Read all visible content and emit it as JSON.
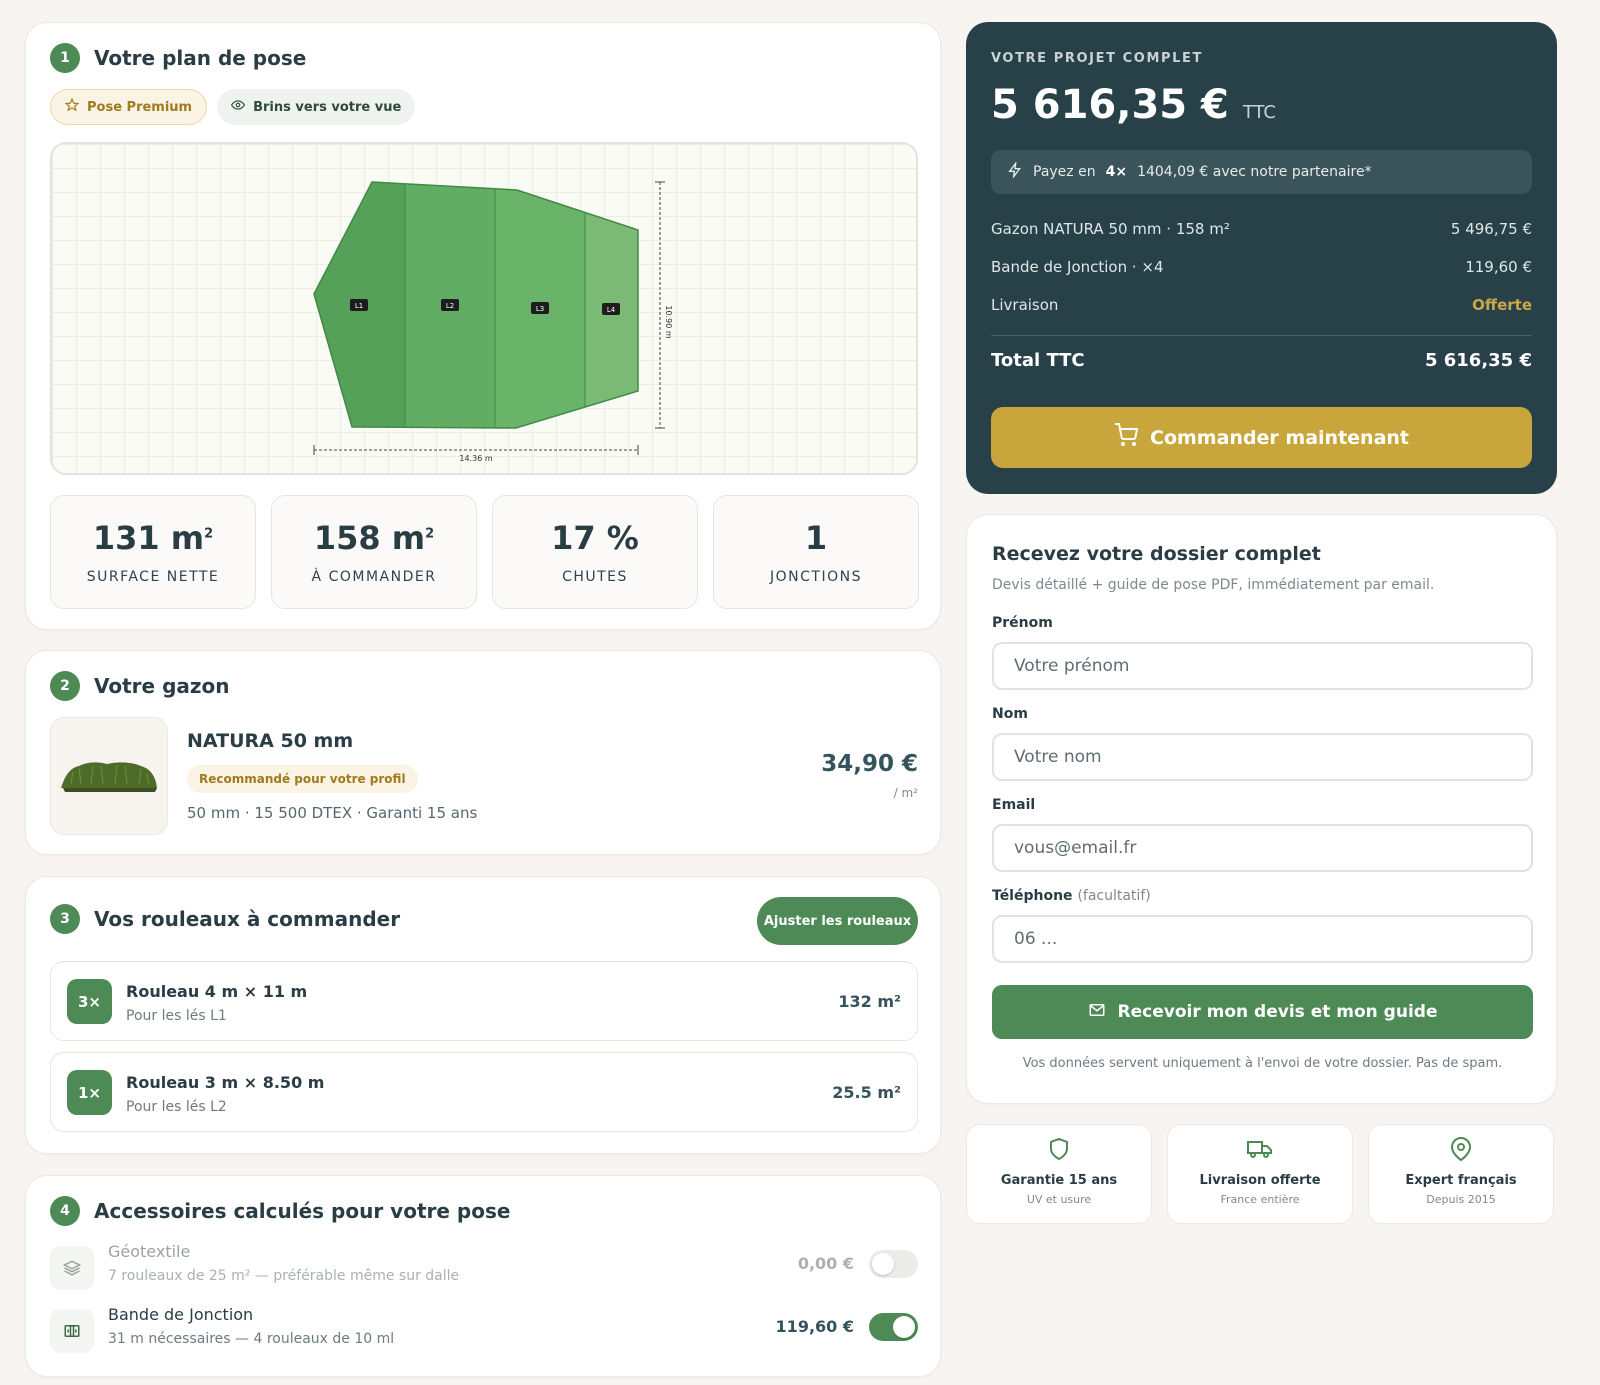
{
  "plan": {
    "number": "1",
    "title": "Votre plan de pose",
    "chip_premium": "Pose Premium",
    "chip_view": "Brins vers votre vue",
    "strip_labels": [
      "L1",
      "L2",
      "L3",
      "L4"
    ],
    "width_label": "14.36 m",
    "height_label": "10.90 m",
    "stats": [
      {
        "value": "131 m",
        "sup": "2",
        "label": "SURFACE NETTE"
      },
      {
        "value": "158 m",
        "sup": "2",
        "label": "À COMMANDER"
      },
      {
        "value": "17 %",
        "sup": "",
        "label": "CHUTES"
      },
      {
        "value": "1",
        "sup": "",
        "label": "JONCTIONS"
      }
    ]
  },
  "gazon": {
    "number": "2",
    "title": "Votre gazon",
    "name": "NATURA 50 mm",
    "badge": "Recommandé pour votre profil",
    "spec": "50 mm · 15 500 DTEX · Garanti 15 ans",
    "price": "34,90 €",
    "unit": "/ m²"
  },
  "rolls": {
    "number": "3",
    "title": "Vos rouleaux à commander",
    "adjust_label": "Ajuster les rouleaux",
    "items": [
      {
        "qty": "3×",
        "name": "Rouleau 4 m × 11 m",
        "sub": "Pour les lés L1",
        "area": "132 m²"
      },
      {
        "qty": "1×",
        "name": "Rouleau 3 m × 8.50 m",
        "sub": "Pour les lés L2",
        "area": "25.5 m²"
      }
    ]
  },
  "accessories": {
    "number": "4",
    "title": "Accessoires calculés pour votre pose",
    "items": [
      {
        "name": "Géotextile",
        "sub": "7 rouleaux de 25 m² — préférable même sur dalle",
        "price": "0,00 €",
        "enabled": false,
        "icon": "layers-icon"
      },
      {
        "name": "Bande de Jonction",
        "sub": "31 m nécessaires — 4 rouleaux de 10 ml",
        "price": "119,60 €",
        "enabled": true,
        "icon": "junction-tape-icon"
      }
    ]
  },
  "summary": {
    "kicker": "VOTRE PROJET COMPLET",
    "total": "5 616,35 €",
    "ttc": "TTC",
    "pay_prefix": "Payez en",
    "pay_times": "4×",
    "pay_suffix": "1404,09 € avec notre partenaire*",
    "rows": [
      {
        "label": "Gazon NATURA 50 mm · 158 m²",
        "value": "5 496,75 €"
      },
      {
        "label": "Bande de Jonction · ×4",
        "value": "119,60 €"
      },
      {
        "label": "Livraison",
        "value": "Offerte"
      }
    ],
    "total_label": "Total TTC",
    "total_value": "5 616,35 €",
    "order_label": "Commander maintenant"
  },
  "form": {
    "title": "Recevez votre dossier complet",
    "subtitle": "Devis détaillé + guide de pose PDF, immédiatement par email.",
    "firstname_label": "Prénom",
    "firstname_placeholder": "Votre prénom",
    "lastname_label": "Nom",
    "lastname_placeholder": "Votre nom",
    "email_label": "Email",
    "email_placeholder": "vous@email.fr",
    "phone_label": "Téléphone",
    "phone_optional": "(facultatif)",
    "phone_placeholder": "06 ...",
    "submit_label": "Recevoir mon devis et mon guide",
    "note": "Vos données servent uniquement à l'envoi de votre dossier. Pas de spam."
  },
  "trust": [
    {
      "title": "Garantie 15 ans",
      "sub": "UV et usure",
      "icon": "shield-icon"
    },
    {
      "title": "Livraison offerte",
      "sub": "France entière",
      "icon": "truck-icon"
    },
    {
      "title": "Expert français",
      "sub": "Depuis 2015",
      "icon": "location-pin-icon"
    }
  ],
  "colors": {
    "brand_green": "#4e8a56",
    "dark_panel": "#284149",
    "gold": "#c9a63c",
    "background": "#f7f4f1"
  }
}
